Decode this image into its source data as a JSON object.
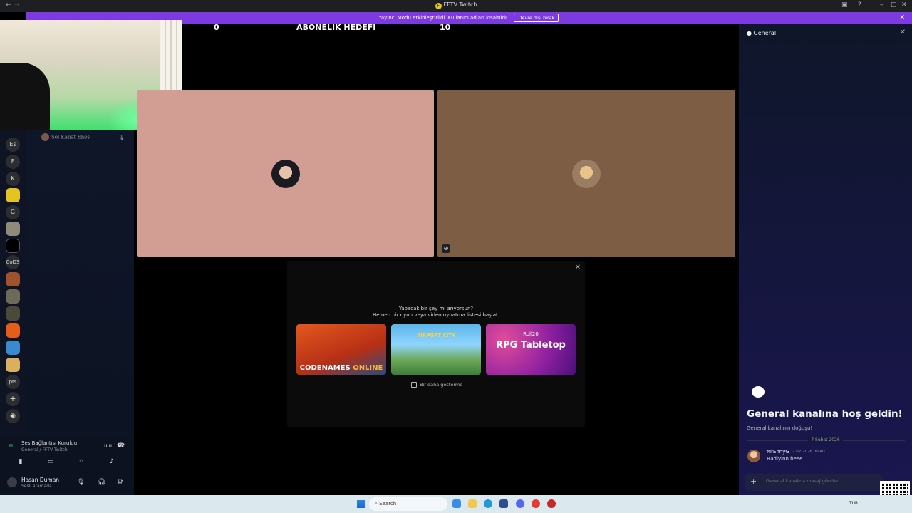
{
  "window": {
    "title": "FFTV Twitch",
    "logo_letter": "F"
  },
  "banner": {
    "text": "Yayıncı Modu etkinleştirildi. Kullanıcı adları kısaltıldı.",
    "button_label": "Devre dışı bırak"
  },
  "servers": [
    "Es",
    "F",
    "K",
    "G",
    "CoDS",
    "pts"
  ],
  "channel": {
    "voice_user": "Sol Kanat Enes"
  },
  "voice_panel": {
    "status": "Ses Bağlantısı Kuruldu",
    "location": "General / FFTV Twitch",
    "username": "Hasan Duman",
    "user_status": "Sesli aramada"
  },
  "stage": {
    "sub_left": "0",
    "sub_title": "ABONELIK HEDEFI",
    "sub_right": "10"
  },
  "activity": {
    "question": "Yapacak bir şey mi arıyorsun?",
    "prompt": "Hemen bir oyun veya video oynatma listesi başlat.",
    "cards": [
      {
        "name": "CODENAMES",
        "name_accent": "ONLINE"
      },
      {
        "name": "AIRPORT CITY"
      },
      {
        "brand": "Roll20",
        "name": "RPG Tabletop"
      }
    ],
    "dont_show": "Bir daha gösterme"
  },
  "chat": {
    "header": "General",
    "welcome_title": "General kanalına hoş geldin!",
    "welcome_sub": "General kanalının doğuşu!",
    "date": "7 Şubat 2026",
    "message": {
      "author": "MrEnnyG",
      "time": "7.02.2026 00:40",
      "text": "Hadiyinn beee"
    },
    "input_placeholder": "General kanalına mesaj gönder"
  },
  "taskbar": {
    "search_placeholder": "Search",
    "lang": "TUR"
  },
  "colors": {
    "banner": "#7d3ae0",
    "tile1": "#d29d92",
    "tile2": "#7e5d45",
    "chat_bg_end": "#1a1650"
  }
}
